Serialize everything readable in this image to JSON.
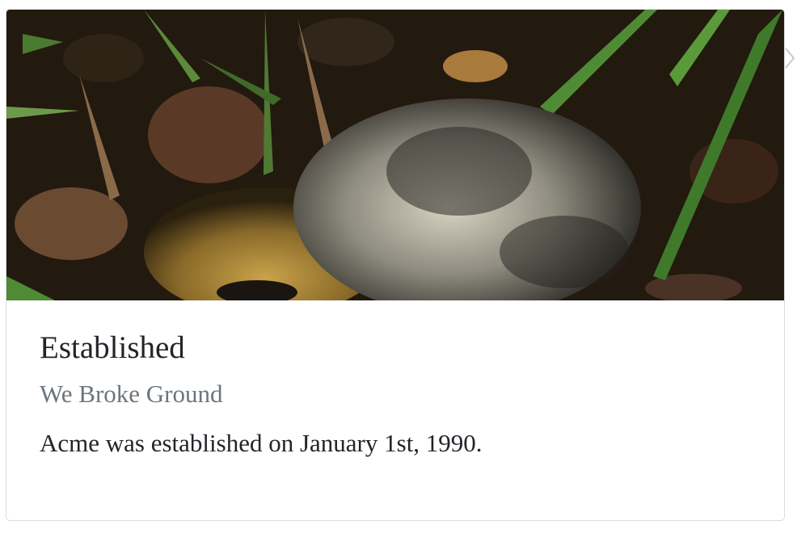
{
  "card": {
    "image_alt": "Porcupine in leaf litter",
    "title": "Established",
    "subtitle": "We Broke Ground",
    "text": "Acme was established on January 1st, 1990."
  },
  "icons": {
    "next": "chevron-right-icon"
  },
  "colors": {
    "title": "#212529",
    "subtitle": "#6c757d",
    "border": "#d9dcdf"
  }
}
